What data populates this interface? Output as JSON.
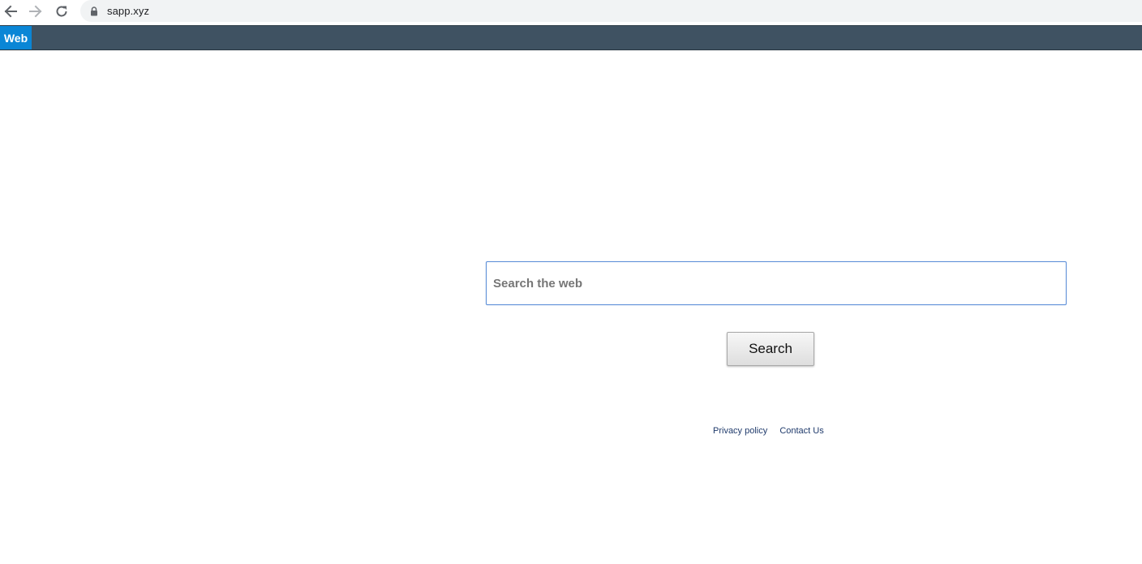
{
  "browser": {
    "url": "sapp.xyz",
    "icons": {
      "back": "arrow-left-icon",
      "forward": "arrow-right-icon",
      "reload": "reload-icon",
      "lock": "lock-icon"
    }
  },
  "site_nav": {
    "tabs": [
      {
        "label": "Web",
        "active": true
      }
    ],
    "colors": {
      "bar": "#3f5262",
      "active_tab": "#0a86d6"
    }
  },
  "search": {
    "placeholder": "Search the web",
    "value": "",
    "button_label": "Search"
  },
  "footer": {
    "links": [
      {
        "label": "Privacy policy"
      },
      {
        "label": "Contact Us"
      }
    ]
  }
}
